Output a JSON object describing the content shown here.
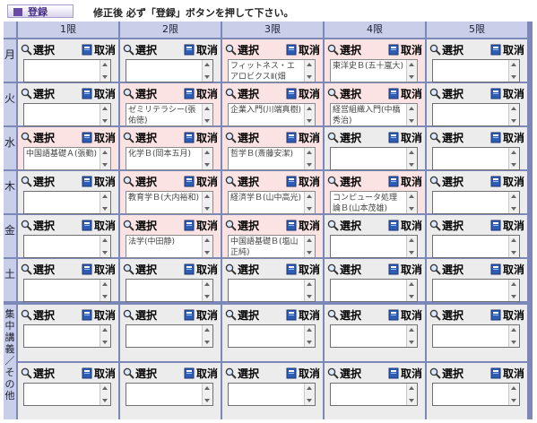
{
  "header": {
    "register_button": "登録",
    "notice": "修正後 必ず「登録」ボタンを押して下さい。"
  },
  "labels": {
    "select": "選択",
    "cancel": "取消"
  },
  "periods": [
    "1限",
    "2限",
    "3限",
    "4限",
    "5限"
  ],
  "rows": [
    {
      "day": "月",
      "cells": [
        "",
        "",
        "フィットネス・エアロビクスⅡ(畑",
        "東洋史Ｂ(五十嵐大)",
        ""
      ]
    },
    {
      "day": "火",
      "cells": [
        "",
        "ゼミリテラシー(張佑徳)",
        "企業入門(川端真樹)",
        "経営組織入門(中橋秀治)",
        ""
      ]
    },
    {
      "day": "水",
      "cells": [
        "中国語基礎Ａ(張勤)",
        "化学Ｂ(岡本五月)",
        "哲学Ｂ(斎藤安潔)",
        "",
        ""
      ]
    },
    {
      "day": "木",
      "cells": [
        "",
        "教育学Ｂ(大内裕和)",
        "経済学Ｂ(山中高光)",
        "コンピュータ処理論Ｂ(山本茂雄)",
        ""
      ]
    },
    {
      "day": "金",
      "cells": [
        "",
        "法学(中田静)",
        "中国語基礎Ｂ(塩山正純)",
        "",
        ""
      ]
    },
    {
      "day": "土",
      "cells": [
        "",
        "",
        "",
        "",
        ""
      ]
    }
  ],
  "intensive": {
    "day": "集中講義／その他",
    "cells": [
      "",
      "",
      "",
      "",
      "",
      "",
      "",
      "",
      "",
      ""
    ]
  },
  "colors": {
    "frame": "#7b88b8",
    "header": "#c9cfe9",
    "pink": "#fbe3e3",
    "gray": "#ececec"
  }
}
